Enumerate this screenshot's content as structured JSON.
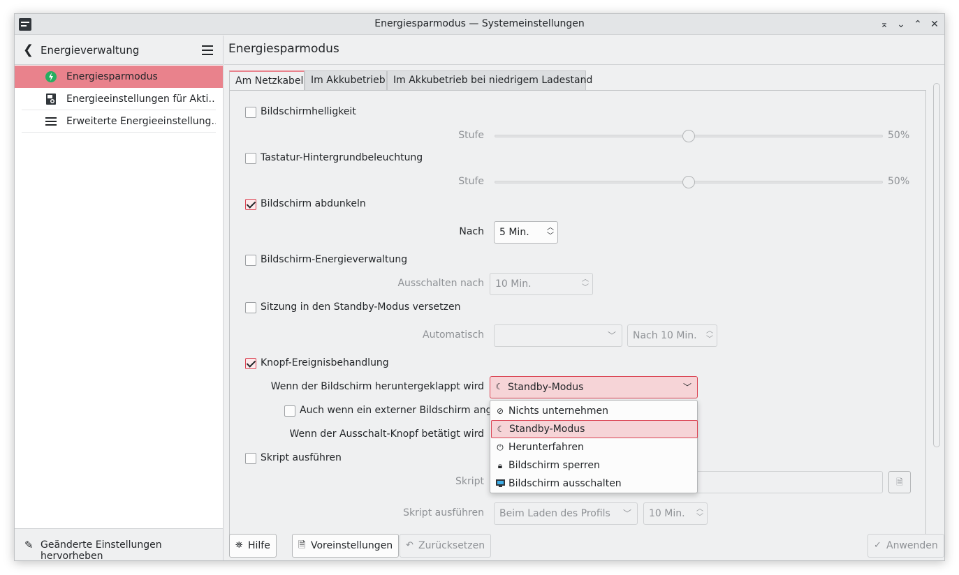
{
  "window": {
    "title": "Energiesparmodus — Systemeinstellungen"
  },
  "titlebar": {
    "keep_above_icon": "⌅",
    "minimize_icon": "⌄",
    "maximize_icon": "⌃",
    "close_icon": "✕"
  },
  "sidebar": {
    "header_title": "Energieverwaltung",
    "items": [
      {
        "label": "Energiesparmodus",
        "icon": "lightning-icon"
      },
      {
        "label": "Energieeinstellungen für Akti…",
        "icon": "activity-icon"
      },
      {
        "label": "Erweiterte Energieeinstellung…",
        "icon": "list-icon"
      }
    ],
    "footer_label": "Geänderte Einstellungen hervorheben"
  },
  "main": {
    "title": "Energiesparmodus",
    "tabs": [
      "Am Netzkabel",
      "Im Akkubetrieb",
      "Im Akkubetrieb bei niedrigem Ladestand"
    ],
    "brightness": {
      "label": "Bildschirmhelligkeit",
      "checked": false,
      "sub_label": "Stufe",
      "value_text": "50%",
      "level": 0.5
    },
    "keyboard": {
      "label": "Tastatur-Hintergrundbeleuchtung",
      "checked": false,
      "sub_label": "Stufe",
      "value_text": "50%",
      "level": 0.5
    },
    "dim": {
      "label": "Bildschirm abdunkeln",
      "checked": true,
      "sub_label": "Nach",
      "value": "5 Min."
    },
    "dpms": {
      "label": "Bildschirm-Energieverwaltung",
      "checked": false,
      "sub_label": "Ausschalten nach",
      "value": "10 Min."
    },
    "standby": {
      "label": "Sitzung in den Standby-Modus versetzen",
      "checked": false,
      "sub_label": "Automatisch",
      "combo_value": "",
      "spin_value": "Nach 10 Min."
    },
    "buttons": {
      "label": "Knopf-Ereignisbehandlung",
      "checked": true,
      "lid_label": "Wenn der Bildschirm heruntergeklappt wird",
      "lid_value": "Standby-Modus",
      "external_label": "Auch wenn ein externer Bildschirm anges",
      "power_label": "Wenn der Ausschalt-Knopf betätigt wird"
    },
    "dropdown_options": [
      {
        "label": "Nichts unternehmen",
        "icon": "no-entry-icon"
      },
      {
        "label": "Standby-Modus",
        "icon": "sleep-icon",
        "selected": true
      },
      {
        "label": "Herunterfahren",
        "icon": "power-icon"
      },
      {
        "label": "Bildschirm sperren",
        "icon": "lock-icon"
      },
      {
        "label": "Bildschirm ausschalten",
        "icon": "monitor-icon"
      }
    ],
    "script": {
      "label": "Skript ausführen",
      "checked": false,
      "sub_label": "Skript",
      "run_label": "Skript ausführen",
      "run_value": "Beim Laden des Profils",
      "run_spin": "10 Min."
    }
  },
  "bottom": {
    "help": "Hilfe",
    "defaults": "Voreinstellungen",
    "reset": "Zurücksetzen",
    "apply": "Anwenden"
  },
  "colors": {
    "accent": "#da4453",
    "selection": "#e9828c"
  }
}
